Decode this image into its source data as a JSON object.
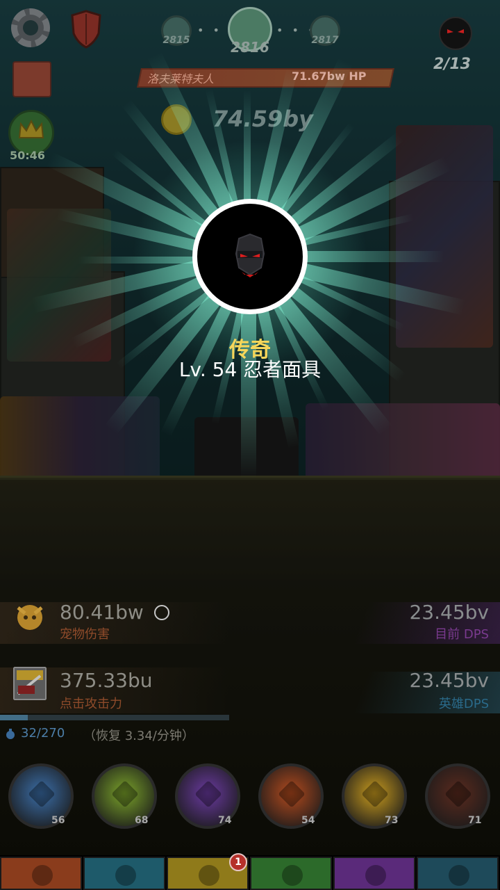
{
  "hud": {
    "stage_prev": "2815",
    "stage_current": "2816",
    "stage_next": "2817",
    "boss_count": "2/13",
    "enemy_name": "洛夫莱特夫人",
    "enemy_hp": "71.67bw HP",
    "gold": "74.59by",
    "crown_timer": "50:46",
    "icons": [
      "gear-icon",
      "shield-icon",
      "shop-icon",
      "crown-icon",
      "boss-skull-icon",
      "gold-coin-icon"
    ]
  },
  "modal": {
    "rarity": "传奇",
    "title": "Lv. 54 忍者面具",
    "icon": "ninja-mask-icon",
    "rarity_color": "#f6d65a"
  },
  "stats": {
    "pet_damage_value": "80.41bw",
    "pet_damage_label": "宠物伤害",
    "current_dps_value": "23.45bv",
    "current_dps_label": "目前 DPS",
    "tap_damage_value": "375.33bu",
    "tap_damage_label": "点击攻击力",
    "hero_dps_value": "23.45bv",
    "hero_dps_label": "英雄DPS"
  },
  "mana": {
    "current": "32/270",
    "regen": "（恢复 3.34/分钟）",
    "fill_fraction": 0.12
  },
  "skills": [
    {
      "name": "heavenly-strike",
      "icon": "eagle-icon",
      "level": "56",
      "color": "#3b6ea8"
    },
    {
      "name": "deadly-strike",
      "icon": "sword-icon",
      "level": "68",
      "color": "#7aa22a"
    },
    {
      "name": "hand-of-midas",
      "icon": "coin-icon",
      "level": "74",
      "color": "#6a3aa0"
    },
    {
      "name": "fire-sword",
      "icon": "flame-sword-icon",
      "level": "54",
      "color": "#b24a1e"
    },
    {
      "name": "war-cry",
      "icon": "axes-icon",
      "level": "73",
      "color": "#c79a1e"
    },
    {
      "name": "shadow-clone",
      "icon": "runner-icon",
      "level": "71",
      "color": "#5a2a1e"
    }
  ],
  "tabs": [
    {
      "name": "sword",
      "color": "#8a3c1c"
    },
    {
      "name": "heroes",
      "color": "#1e5a6a"
    },
    {
      "name": "equipment",
      "color": "#8f7a1a",
      "badge": "1"
    },
    {
      "name": "pets",
      "color": "#2c6a2a"
    },
    {
      "name": "artifacts",
      "color": "#5a2a7a"
    },
    {
      "name": "ranking",
      "color": "#1e4a5a"
    }
  ]
}
